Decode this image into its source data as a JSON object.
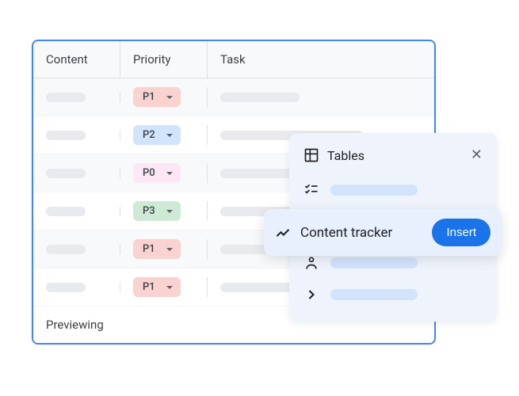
{
  "table": {
    "columns": {
      "content": "Content",
      "priority": "Priority",
      "task": "Task"
    },
    "rows": [
      {
        "priority": "P1",
        "priority_color": "p-red",
        "task_len": "short"
      },
      {
        "priority": "P2",
        "priority_color": "p-blue",
        "task_len": "long"
      },
      {
        "priority": "P0",
        "priority_color": "p-pink",
        "task_len": "short"
      },
      {
        "priority": "P3",
        "priority_color": "p-green",
        "task_len": "long"
      },
      {
        "priority": "P1",
        "priority_color": "p-red",
        "task_len": "short"
      },
      {
        "priority": "P1",
        "priority_color": "p-red",
        "task_len": "long"
      }
    ],
    "footer": "Previewing"
  },
  "popup": {
    "title": "Tables",
    "highlight": {
      "label": "Content tracker",
      "button": "Insert"
    }
  }
}
